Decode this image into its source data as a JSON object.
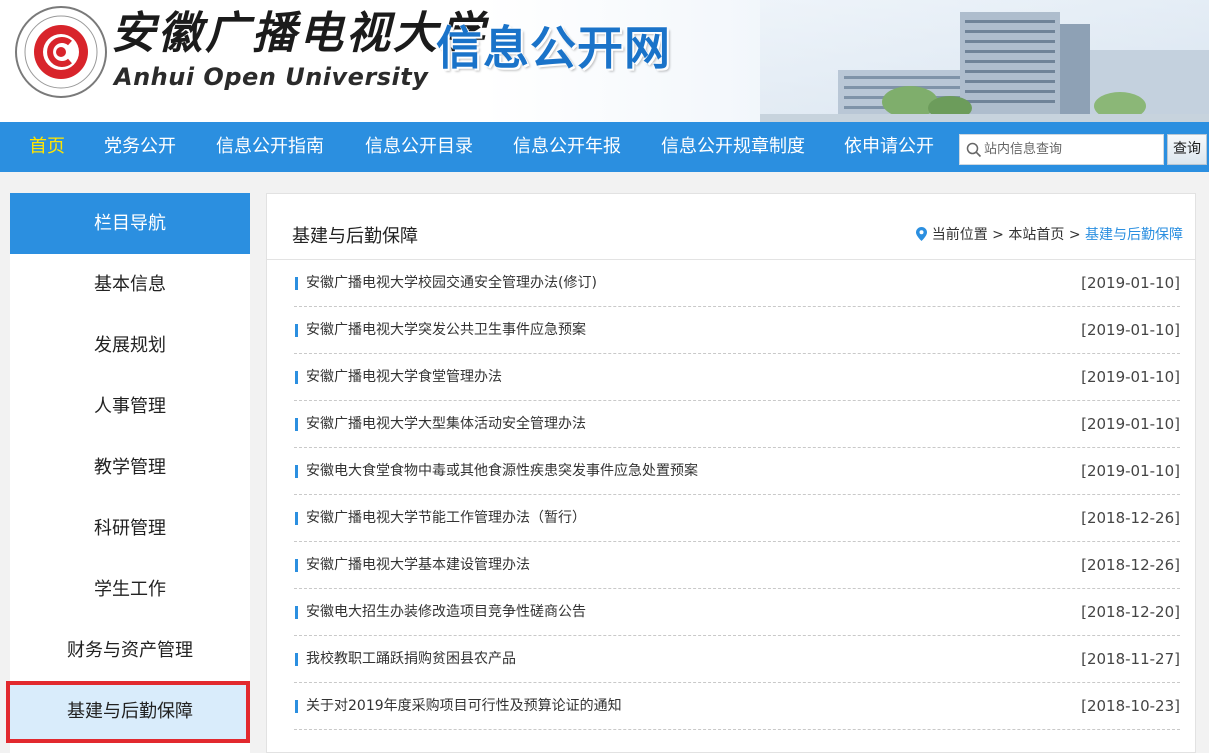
{
  "header": {
    "logo_cn": "安徽广播电视大学",
    "logo_en": "Anhui Open University",
    "site_title": "信息公开网"
  },
  "nav": {
    "items": [
      {
        "label": "首页",
        "active": true
      },
      {
        "label": "党务公开"
      },
      {
        "label": "信息公开指南"
      },
      {
        "label": "信息公开目录"
      },
      {
        "label": "信息公开年报"
      },
      {
        "label": "信息公开规章制度"
      },
      {
        "label": "依申请公开"
      }
    ],
    "search_placeholder": "站内信息查询",
    "search_button": "查询"
  },
  "sidebar": {
    "title": "栏目导航",
    "items": [
      {
        "label": "基本信息"
      },
      {
        "label": "发展规划"
      },
      {
        "label": "人事管理"
      },
      {
        "label": "教学管理"
      },
      {
        "label": "科研管理"
      },
      {
        "label": "学生工作"
      },
      {
        "label": "财务与资产管理"
      },
      {
        "label": "基建与后勤保障",
        "active": true
      }
    ]
  },
  "main": {
    "title": "基建与后勤保障",
    "breadcrumb": {
      "prefix": "当前位置",
      "sep": ">",
      "home": "本站首页",
      "current": "基建与后勤保障"
    },
    "news": [
      {
        "title": "安徽广播电视大学校园交通安全管理办法(修订)",
        "date": "[2019-01-10]"
      },
      {
        "title": "安徽广播电视大学突发公共卫生事件应急预案",
        "date": "[2019-01-10]"
      },
      {
        "title": "安徽广播电视大学食堂管理办法",
        "date": "[2019-01-10]"
      },
      {
        "title": "安徽广播电视大学大型集体活动安全管理办法",
        "date": "[2019-01-10]"
      },
      {
        "title": "安徽电大食堂食物中毒或其他食源性疾患突发事件应急处置预案",
        "date": "[2019-01-10]"
      },
      {
        "title": "安徽广播电视大学节能工作管理办法（暂行）",
        "date": "[2018-12-26]"
      },
      {
        "title": "安徽广播电视大学基本建设管理办法",
        "date": "[2018-12-26]"
      },
      {
        "title": "安徽电大招生办装修改造项目竞争性磋商公告",
        "date": "[2018-12-20]"
      },
      {
        "title": "我校教职工踊跃捐购贫困县农产品",
        "date": "[2018-11-27]"
      },
      {
        "title": "关于对2019年度采购项目可行性及预算论证的通知",
        "date": "[2018-10-23]"
      }
    ]
  },
  "colors": {
    "nav_bg": "#2b8fe0",
    "nav_active": "#ffe400",
    "accent": "#2b8fe0",
    "highlight_border": "#e2292e",
    "sidebar_active_bg": "#d9ecfb"
  }
}
